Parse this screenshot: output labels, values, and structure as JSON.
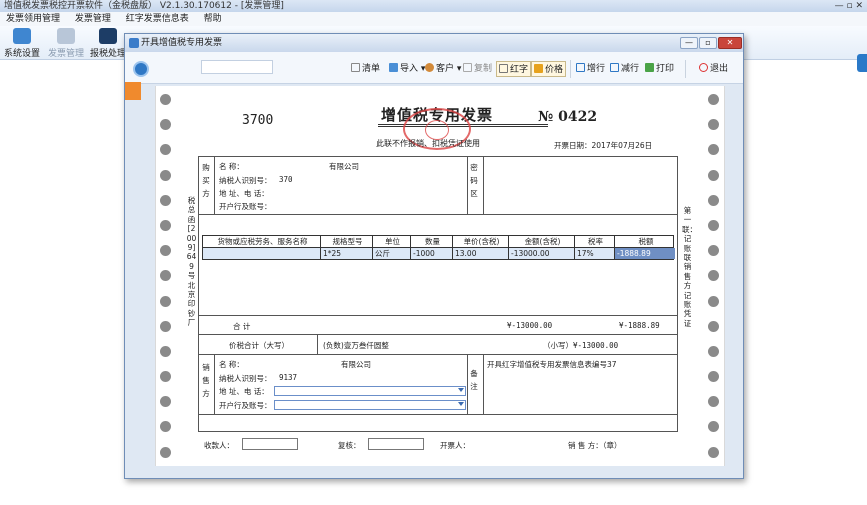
{
  "app": {
    "title": "增值税发票税控开票软件（金税盘版） V2.1.30.170612 - [发票管理]",
    "menu": [
      "发票领用管理",
      "发票管理",
      "红字发票信息表",
      "帮助"
    ],
    "toolbar": [
      "系统设置",
      "发票管理",
      "报税处理"
    ],
    "window_controls": "— ▫ ✕"
  },
  "dialog": {
    "title": "开具增值税专用发票",
    "min": "—",
    "max": "▫",
    "close": "✕",
    "toolbar": {
      "list": "清单",
      "import": "导入",
      "customer": "客户",
      "copy": "复制",
      "red": "红字",
      "price": "价格",
      "add_row": "增行",
      "del_row": "减行",
      "print": "打印",
      "exit": "退出"
    }
  },
  "invoice": {
    "code": "3700",
    "title": "增值税专用发票",
    "number": "№ 0422",
    "subtitle": "此联不作报销、扣税凭证使用",
    "date": "开票日期：2017年07月26日",
    "buyer_label": "购买方",
    "buyer": {
      "name_label": "名      称：",
      "name_value": "有限公司",
      "tax_id_label": "纳税人识别号：",
      "tax_id_value": "370",
      "addr_label": "地  址、电 话：",
      "bank_label": "开户行及账号："
    },
    "cipher_label": "密码区",
    "headers": [
      "货物或应税劳务、服务名称",
      "规格型号",
      "单位",
      "数量",
      "单价(含税)",
      "金额(含税)",
      "税率",
      "税额"
    ],
    "rows": [
      [
        "",
        "1*25",
        "公斤",
        "-1000",
        "13.00",
        "-13000.00",
        "17%",
        "-1888.89"
      ]
    ],
    "total_label": "合      计",
    "total_amount": "¥-13000.00",
    "total_tax": "¥-1888.89",
    "grand_label": "价税合计（大写）",
    "grand_chinese": "(负数)壹万叁仟圆整",
    "grand_small": "（小写）¥-13000.00",
    "seller_label": "销售方",
    "seller": {
      "name_label": "名      称：",
      "name_value": "有限公司",
      "tax_id_label": "纳税人识别号：",
      "tax_id_value": "9137",
      "addr_label": "地  址、电 话：",
      "bank_label": "开户行及账号："
    },
    "remark_label": "备注",
    "remark_text": "开具红字增值税专用发票信息表编号37",
    "payee_label": "收款人：",
    "reviewer_label": "复核：",
    "issuer_label": "开票人：",
    "seller_seal_label": "销 售 方：（章）",
    "left_side_text": "税总函[2009]649号北京印钞厂",
    "right_side_text": "第一联：记账联 销售方记账凭证"
  },
  "colors": {
    "accent": "#2f78c5",
    "grid_selected": "#6f8fc4",
    "grid_row": "#dce8f7",
    "seal": "#dd4444"
  }
}
